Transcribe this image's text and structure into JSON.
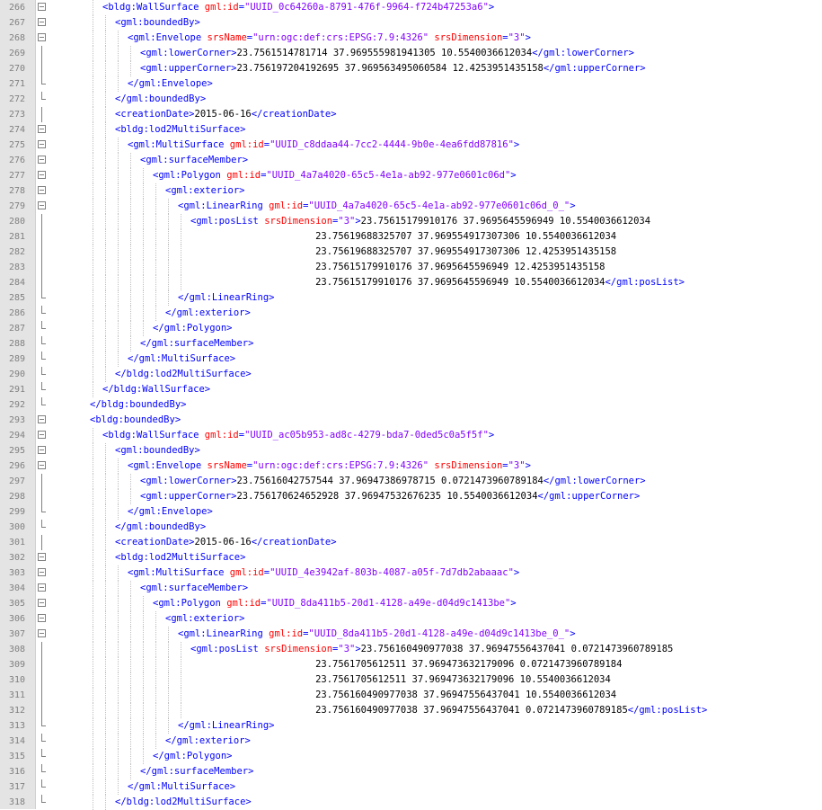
{
  "editor": {
    "lines": [
      {
        "n": "266",
        "d": 4,
        "fold": "box",
        "parts": [
          [
            "t",
            "<bldg:WallSurface"
          ],
          [
            "s",
            " "
          ],
          [
            "a",
            "gml:id"
          ],
          [
            "t",
            "="
          ],
          [
            "v",
            "\"UUID_0c64260a-8791-476f-9964-f724b47253a6\""
          ],
          [
            "t",
            ">"
          ]
        ]
      },
      {
        "n": "267",
        "d": 5,
        "fold": "box",
        "parts": [
          [
            "t",
            "<gml:boundedBy>"
          ]
        ]
      },
      {
        "n": "268",
        "d": 6,
        "fold": "box",
        "parts": [
          [
            "t",
            "<gml:Envelope"
          ],
          [
            "s",
            " "
          ],
          [
            "a",
            "srsName"
          ],
          [
            "t",
            "="
          ],
          [
            "v",
            "\"urn:ogc:def:crs:EPSG:7.9:4326\""
          ],
          [
            "s",
            " "
          ],
          [
            "a",
            "srsDimension"
          ],
          [
            "t",
            "="
          ],
          [
            "v",
            "\"3\""
          ],
          [
            "t",
            ">"
          ]
        ]
      },
      {
        "n": "269",
        "d": 7,
        "fold": "mid",
        "parts": [
          [
            "t",
            "<gml:lowerCorner>"
          ],
          [
            "x",
            "23.7561514781714 37.969555981941305 10.5540036612034"
          ],
          [
            "t",
            "</gml:lowerCorner>"
          ]
        ]
      },
      {
        "n": "270",
        "d": 7,
        "fold": "mid",
        "parts": [
          [
            "t",
            "<gml:upperCorner>"
          ],
          [
            "x",
            "23.756197204192695 37.969563495060584 12.4253951435158"
          ],
          [
            "t",
            "</gml:upperCorner>"
          ]
        ]
      },
      {
        "n": "271",
        "d": 6,
        "fold": "end",
        "parts": [
          [
            "t",
            "</gml:Envelope>"
          ]
        ]
      },
      {
        "n": "272",
        "d": 5,
        "fold": "end",
        "parts": [
          [
            "t",
            "</gml:boundedBy>"
          ]
        ]
      },
      {
        "n": "273",
        "d": 5,
        "fold": "mid",
        "parts": [
          [
            "t",
            "<creationDate>"
          ],
          [
            "x",
            "2015-06-16"
          ],
          [
            "t",
            "</creationDate>"
          ]
        ]
      },
      {
        "n": "274",
        "d": 5,
        "fold": "box",
        "parts": [
          [
            "t",
            "<bldg:lod2MultiSurface>"
          ]
        ]
      },
      {
        "n": "275",
        "d": 6,
        "fold": "box",
        "parts": [
          [
            "t",
            "<gml:MultiSurface"
          ],
          [
            "s",
            " "
          ],
          [
            "a",
            "gml:id"
          ],
          [
            "t",
            "="
          ],
          [
            "v",
            "\"UUID_c8ddaa44-7cc2-4444-9b0e-4ea6fdd87816\""
          ],
          [
            "t",
            ">"
          ]
        ]
      },
      {
        "n": "276",
        "d": 7,
        "fold": "box",
        "parts": [
          [
            "t",
            "<gml:surfaceMember>"
          ]
        ]
      },
      {
        "n": "277",
        "d": 8,
        "fold": "box",
        "parts": [
          [
            "t",
            "<gml:Polygon"
          ],
          [
            "s",
            " "
          ],
          [
            "a",
            "gml:id"
          ],
          [
            "t",
            "="
          ],
          [
            "v",
            "\"UUID_4a7a4020-65c5-4e1a-ab92-977e0601c06d\""
          ],
          [
            "t",
            ">"
          ]
        ]
      },
      {
        "n": "278",
        "d": 9,
        "fold": "box",
        "parts": [
          [
            "t",
            "<gml:exterior>"
          ]
        ]
      },
      {
        "n": "279",
        "d": 10,
        "fold": "box",
        "parts": [
          [
            "t",
            "<gml:LinearRing"
          ],
          [
            "s",
            " "
          ],
          [
            "a",
            "gml:id"
          ],
          [
            "t",
            "="
          ],
          [
            "v",
            "\"UUID_4a7a4020-65c5-4e1a-ab92-977e0601c06d_0_\""
          ],
          [
            "t",
            ">"
          ]
        ]
      },
      {
        "n": "280",
        "d": 11,
        "fold": "mid",
        "parts": [
          [
            "t",
            "<gml:posList"
          ],
          [
            "s",
            " "
          ],
          [
            "a",
            "srsDimension"
          ],
          [
            "t",
            "="
          ],
          [
            "v",
            "\"3\""
          ],
          [
            "t",
            ">"
          ],
          [
            "x",
            "23.75615179910176 37.9695645596949 10.5540036612034"
          ]
        ]
      },
      {
        "n": "281",
        "d": 11,
        "fold": "mid",
        "pad": "                      ",
        "parts": [
          [
            "x",
            "23.75619688325707 37.969554917307306 10.5540036612034"
          ]
        ]
      },
      {
        "n": "282",
        "d": 11,
        "fold": "mid",
        "pad": "                      ",
        "parts": [
          [
            "x",
            "23.75619688325707 37.969554917307306 12.4253951435158"
          ]
        ]
      },
      {
        "n": "283",
        "d": 11,
        "fold": "mid",
        "pad": "                      ",
        "parts": [
          [
            "x",
            "23.75615179910176 37.9695645596949 12.4253951435158"
          ]
        ]
      },
      {
        "n": "284",
        "d": 11,
        "fold": "mid",
        "pad": "                      ",
        "parts": [
          [
            "x",
            "23.75615179910176 37.9695645596949 10.5540036612034"
          ],
          [
            "t",
            "</gml:posList>"
          ]
        ]
      },
      {
        "n": "285",
        "d": 10,
        "fold": "end",
        "parts": [
          [
            "t",
            "</gml:LinearRing>"
          ]
        ]
      },
      {
        "n": "286",
        "d": 9,
        "fold": "end",
        "parts": [
          [
            "t",
            "</gml:exterior>"
          ]
        ]
      },
      {
        "n": "287",
        "d": 8,
        "fold": "end",
        "parts": [
          [
            "t",
            "</gml:Polygon>"
          ]
        ]
      },
      {
        "n": "288",
        "d": 7,
        "fold": "end",
        "parts": [
          [
            "t",
            "</gml:surfaceMember>"
          ]
        ]
      },
      {
        "n": "289",
        "d": 6,
        "fold": "end",
        "parts": [
          [
            "t",
            "</gml:MultiSurface>"
          ]
        ]
      },
      {
        "n": "290",
        "d": 5,
        "fold": "end",
        "parts": [
          [
            "t",
            "</bldg:lod2MultiSurface>"
          ]
        ]
      },
      {
        "n": "291",
        "d": 4,
        "fold": "end",
        "parts": [
          [
            "t",
            "</bldg:WallSurface>"
          ]
        ]
      },
      {
        "n": "292",
        "d": 3,
        "fold": "end",
        "parts": [
          [
            "t",
            "</bldg:boundedBy>"
          ]
        ]
      },
      {
        "n": "293",
        "d": 3,
        "fold": "box",
        "parts": [
          [
            "t",
            "<bldg:boundedBy>"
          ]
        ]
      },
      {
        "n": "294",
        "d": 4,
        "fold": "box",
        "parts": [
          [
            "t",
            "<bldg:WallSurface"
          ],
          [
            "s",
            " "
          ],
          [
            "a",
            "gml:id"
          ],
          [
            "t",
            "="
          ],
          [
            "v",
            "\"UUID_ac05b953-ad8c-4279-bda7-0ded5c0a5f5f\""
          ],
          [
            "t",
            ">"
          ]
        ]
      },
      {
        "n": "295",
        "d": 5,
        "fold": "box",
        "parts": [
          [
            "t",
            "<gml:boundedBy>"
          ]
        ]
      },
      {
        "n": "296",
        "d": 6,
        "fold": "box",
        "parts": [
          [
            "t",
            "<gml:Envelope"
          ],
          [
            "s",
            " "
          ],
          [
            "a",
            "srsName"
          ],
          [
            "t",
            "="
          ],
          [
            "v",
            "\"urn:ogc:def:crs:EPSG:7.9:4326\""
          ],
          [
            "s",
            " "
          ],
          [
            "a",
            "srsDimension"
          ],
          [
            "t",
            "="
          ],
          [
            "v",
            "\"3\""
          ],
          [
            "t",
            ">"
          ]
        ]
      },
      {
        "n": "297",
        "d": 7,
        "fold": "mid",
        "parts": [
          [
            "t",
            "<gml:lowerCorner>"
          ],
          [
            "x",
            "23.75616042757544 37.96947386978715 0.0721473960789184"
          ],
          [
            "t",
            "</gml:lowerCorner>"
          ]
        ]
      },
      {
        "n": "298",
        "d": 7,
        "fold": "mid",
        "parts": [
          [
            "t",
            "<gml:upperCorner>"
          ],
          [
            "x",
            "23.756170624652928 37.96947532676235 10.5540036612034"
          ],
          [
            "t",
            "</gml:upperCorner>"
          ]
        ]
      },
      {
        "n": "299",
        "d": 6,
        "fold": "end",
        "parts": [
          [
            "t",
            "</gml:Envelope>"
          ]
        ]
      },
      {
        "n": "300",
        "d": 5,
        "fold": "end",
        "parts": [
          [
            "t",
            "</gml:boundedBy>"
          ]
        ]
      },
      {
        "n": "301",
        "d": 5,
        "fold": "mid",
        "parts": [
          [
            "t",
            "<creationDate>"
          ],
          [
            "x",
            "2015-06-16"
          ],
          [
            "t",
            "</creationDate>"
          ]
        ]
      },
      {
        "n": "302",
        "d": 5,
        "fold": "box",
        "parts": [
          [
            "t",
            "<bldg:lod2MultiSurface>"
          ]
        ]
      },
      {
        "n": "303",
        "d": 6,
        "fold": "box",
        "parts": [
          [
            "t",
            "<gml:MultiSurface"
          ],
          [
            "s",
            " "
          ],
          [
            "a",
            "gml:id"
          ],
          [
            "t",
            "="
          ],
          [
            "v",
            "\"UUID_4e3942af-803b-4087-a05f-7d7db2abaaac\""
          ],
          [
            "t",
            ">"
          ]
        ]
      },
      {
        "n": "304",
        "d": 7,
        "fold": "box",
        "parts": [
          [
            "t",
            "<gml:surfaceMember>"
          ]
        ]
      },
      {
        "n": "305",
        "d": 8,
        "fold": "box",
        "parts": [
          [
            "t",
            "<gml:Polygon"
          ],
          [
            "s",
            " "
          ],
          [
            "a",
            "gml:id"
          ],
          [
            "t",
            "="
          ],
          [
            "v",
            "\"UUID_8da411b5-20d1-4128-a49e-d04d9c1413be\""
          ],
          [
            "t",
            ">"
          ]
        ]
      },
      {
        "n": "306",
        "d": 9,
        "fold": "box",
        "parts": [
          [
            "t",
            "<gml:exterior>"
          ]
        ]
      },
      {
        "n": "307",
        "d": 10,
        "fold": "box",
        "parts": [
          [
            "t",
            "<gml:LinearRing"
          ],
          [
            "s",
            " "
          ],
          [
            "a",
            "gml:id"
          ],
          [
            "t",
            "="
          ],
          [
            "v",
            "\"UUID_8da411b5-20d1-4128-a49e-d04d9c1413be_0_\""
          ],
          [
            "t",
            ">"
          ]
        ]
      },
      {
        "n": "308",
        "d": 11,
        "fold": "mid",
        "parts": [
          [
            "t",
            "<gml:posList"
          ],
          [
            "s",
            " "
          ],
          [
            "a",
            "srsDimension"
          ],
          [
            "t",
            "="
          ],
          [
            "v",
            "\"3\""
          ],
          [
            "t",
            ">"
          ],
          [
            "x",
            "23.756160490977038 37.96947556437041 0.0721473960789185"
          ]
        ]
      },
      {
        "n": "309",
        "d": 11,
        "fold": "mid",
        "pad": "                      ",
        "parts": [
          [
            "x",
            "23.7561705612511 37.969473632179096 0.0721473960789184"
          ]
        ]
      },
      {
        "n": "310",
        "d": 11,
        "fold": "mid",
        "pad": "                      ",
        "parts": [
          [
            "x",
            "23.7561705612511 37.969473632179096 10.5540036612034"
          ]
        ]
      },
      {
        "n": "311",
        "d": 11,
        "fold": "mid",
        "pad": "                      ",
        "parts": [
          [
            "x",
            "23.756160490977038 37.96947556437041 10.5540036612034"
          ]
        ]
      },
      {
        "n": "312",
        "d": 11,
        "fold": "mid",
        "pad": "                      ",
        "parts": [
          [
            "x",
            "23.756160490977038 37.96947556437041 0.0721473960789185"
          ],
          [
            "t",
            "</gml:posList>"
          ]
        ]
      },
      {
        "n": "313",
        "d": 10,
        "fold": "end",
        "parts": [
          [
            "t",
            "</gml:LinearRing>"
          ]
        ]
      },
      {
        "n": "314",
        "d": 9,
        "fold": "end",
        "parts": [
          [
            "t",
            "</gml:exterior>"
          ]
        ]
      },
      {
        "n": "315",
        "d": 8,
        "fold": "end",
        "parts": [
          [
            "t",
            "</gml:Polygon>"
          ]
        ]
      },
      {
        "n": "316",
        "d": 7,
        "fold": "end",
        "parts": [
          [
            "t",
            "</gml:surfaceMember>"
          ]
        ]
      },
      {
        "n": "317",
        "d": 6,
        "fold": "end",
        "parts": [
          [
            "t",
            "</gml:MultiSurface>"
          ]
        ]
      },
      {
        "n": "318",
        "d": 5,
        "fold": "end",
        "parts": [
          [
            "t",
            "</bldg:lod2MultiSurface>"
          ]
        ]
      }
    ]
  },
  "colors": {
    "tag": "#0000ff",
    "attribute": "#ff0000",
    "value": "#8000ff",
    "text": "#000000",
    "line_number": "#808080",
    "gutter": "#e4e4e4"
  }
}
